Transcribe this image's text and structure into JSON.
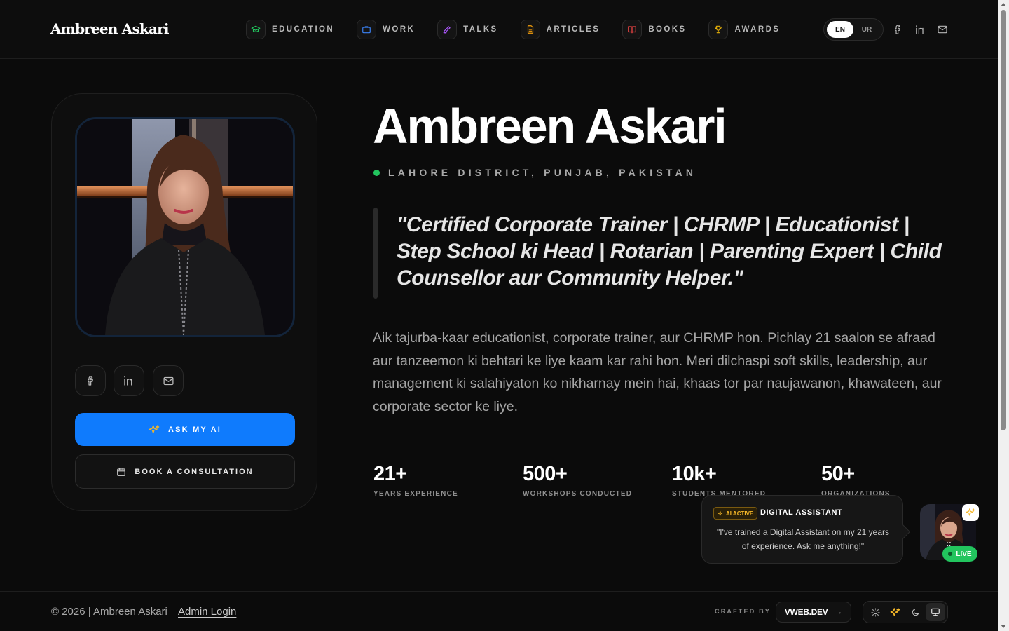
{
  "header": {
    "brand": "Ambreen Askari",
    "nav": [
      {
        "label": "EDUCATION",
        "icon": "graduation-cap-icon",
        "color": "#22c55e"
      },
      {
        "label": "WORK",
        "icon": "briefcase-icon",
        "color": "#3b82f6"
      },
      {
        "label": "TALKS",
        "icon": "pen-icon",
        "color": "#a855f7"
      },
      {
        "label": "ARTICLES",
        "icon": "document-icon",
        "color": "#f59e0b"
      },
      {
        "label": "BOOKS",
        "icon": "book-icon",
        "color": "#ef4444"
      },
      {
        "label": "AWARDS",
        "icon": "trophy-icon",
        "color": "#eab308"
      }
    ],
    "lang": {
      "en": "EN",
      "ur": "UR",
      "selected": "EN"
    }
  },
  "profile": {
    "ask_ai_label": "ASK MY AI",
    "book_label": "BOOK A CONSULTATION"
  },
  "hero": {
    "name": "Ambreen Askari",
    "location": "LAHORE DISTRICT, PUNJAB, PAKISTAN",
    "quote": "\"Certified Corporate Trainer | CHRMP | Educationist | Step School ki Head | Rotarian | Parenting Expert | Child Counsellor aur Community Helper.\"",
    "bio": "Aik tajurba-kaar educationist, corporate trainer, aur CHRMP hon. Pichlay 21 saalon se afraad aur tanzeemon ki behtari ke liye kaam kar rahi hon. Meri dilchaspi soft skills, leadership, aur management ki salahiyaton ko nikharnay mein hai, khaas tor par naujawanon, khawateen, aur corporate sector ke liye."
  },
  "stats": [
    {
      "value": "21+",
      "label": "YEARS EXPERIENCE"
    },
    {
      "value": "500+",
      "label": "WORKSHOPS CONDUCTED"
    },
    {
      "value": "10k+",
      "label": "STUDENTS MENTORED"
    },
    {
      "value": "50+",
      "label": "ORGANIZATIONS"
    }
  ],
  "assistant": {
    "badge": "AI ACTIVE",
    "title": "DIGITAL ASSISTANT",
    "message": "\"I've trained a Digital Assistant on my 21 years of experience. Ask me anything!\"",
    "live": "LIVE"
  },
  "footer": {
    "copyright": "© 2026 | Ambreen Askari",
    "admin": "Admin Login",
    "crafted_by": "CRAFTED BY",
    "vweb": "VWEB.DEV"
  },
  "colors": {
    "accent": "#0f7bfd",
    "live": "#22c55e",
    "ai_badge": "#f5b728"
  }
}
